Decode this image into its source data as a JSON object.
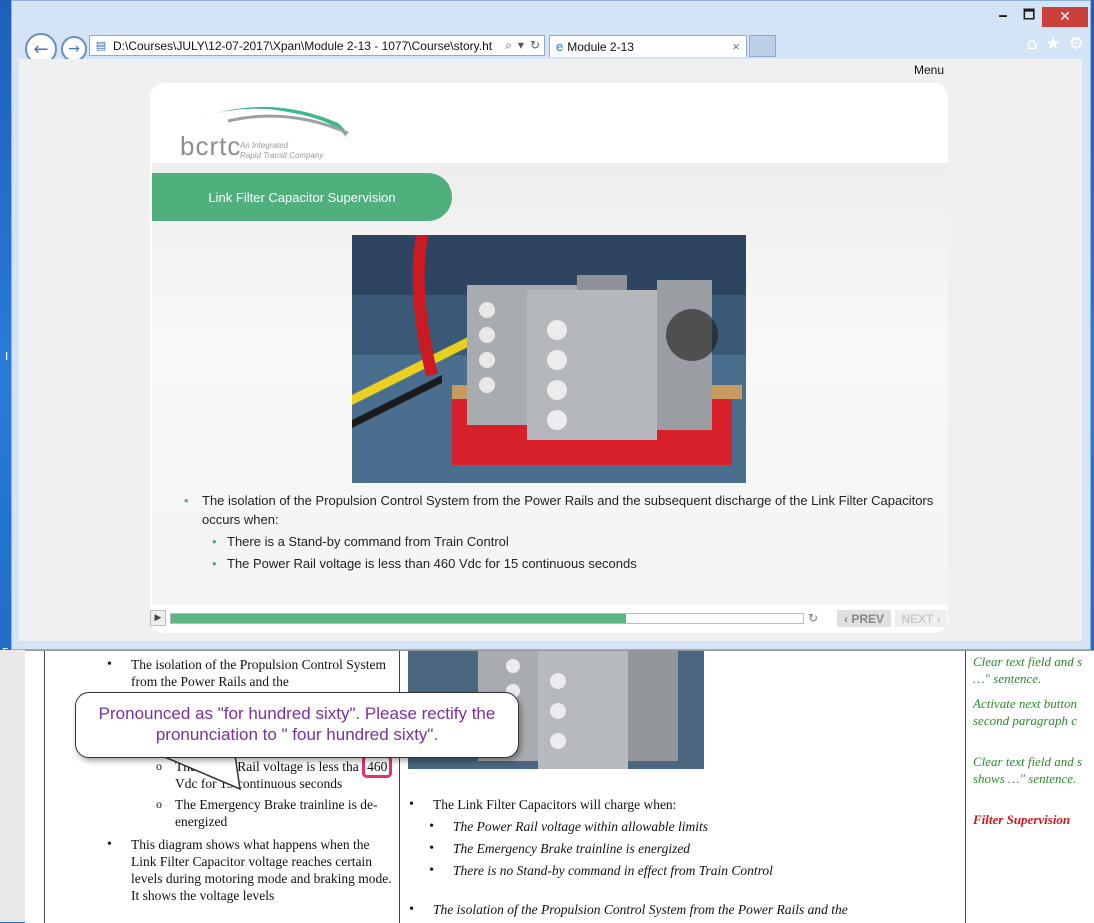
{
  "browser": {
    "address": "D:\\Courses\\JULY\\12-07-2017\\Xpan\\Module 2-13 - 1077\\Course\\story.ht",
    "tab_title": "Module 2-13",
    "window_buttons": {
      "minimize": "🗕",
      "maximize": "🗖",
      "close": "✕"
    },
    "tab_close": "×"
  },
  "player": {
    "menu_label": "Menu",
    "logo_text": "bcrtc",
    "logo_tag_line1": "An Integrated",
    "logo_tag_line2": "Rapid Transit Company",
    "slide_title": "Link Filter Capacitor Supervision",
    "bullet_main": "The isolation of the Propulsion Control System from the Power Rails and the subsequent discharge of the Link Filter Capacitors occurs when:",
    "bullet_sub1": "There is a Stand-by command from Train Control",
    "bullet_sub2": "The Power Rail voltage is less than 460 Vdc for 15 continuous seconds",
    "progress_fraction": 0.72,
    "prev_label": "‹ PREV",
    "next_label": "NEXT ›"
  },
  "doc": {
    "col1_item1": "The isolation of the Propulsion Control System from the Power Rails and the",
    "col1_sub_pre": "The Power Rail voltage is less tha",
    "col1_sub_highlight": "460",
    "col1_sub_post": "Vdc for 15 continuous seconds",
    "col1_sub2": "The Emergency Brake trainline is de-energized",
    "col1_item2": "This diagram  shows what happens when the Link Filter Capacitor voltage reaches certain levels during motoring mode and braking mode. It shows the voltage levels",
    "col2_heading": "The Link Filter Capacitors will charge when:",
    "col2_sub1": "The Power Rail voltage within allowable limits",
    "col2_sub2": "The Emergency Brake trainline is energized",
    "col2_sub3": "There is no Stand-by command in effect from Train Control",
    "col2_bottom": "The isolation of the Propulsion Control System from the Power Rails and the",
    "col3_note1": "Clear text field and s …\" sentence.",
    "col3_note2": "Activate next button second paragraph c",
    "col3_note3": "Clear text field and s shows …\" sentence.",
    "col3_note4": "Filter Supervision"
  },
  "callout": {
    "text": "Pronounced as \"for hundred sixty\". Please rectify the pronunciation to \" four hundred sixty\"."
  },
  "desktop": {
    "frag1": "Fo",
    "frag2": "I"
  }
}
